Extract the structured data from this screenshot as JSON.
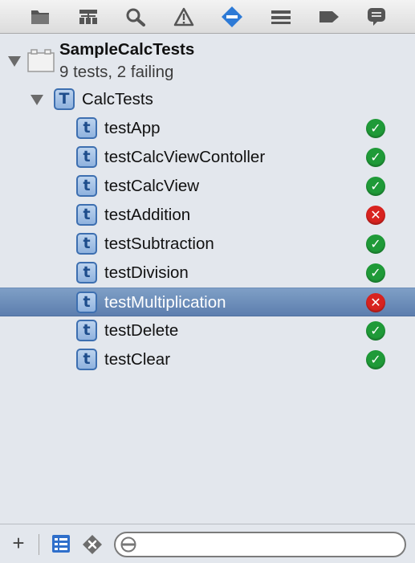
{
  "toolbar": {
    "icons": [
      "folder-icon",
      "hierarchy-icon",
      "search-icon",
      "warning-icon",
      "test-navigator-icon",
      "breakpoint-list-icon",
      "tag-icon",
      "speech-bubble-icon"
    ],
    "active": "test-navigator-icon",
    "accent": "#2d7ad6"
  },
  "tree": {
    "project": {
      "name": "SampleCalcTests",
      "summary": "9 tests, 2 failing"
    },
    "target": {
      "icon_letter": "T",
      "name": "CalcTests"
    },
    "tests": [
      {
        "icon_letter": "t",
        "name": "testApp",
        "status": "pass",
        "status_glyph": "✓"
      },
      {
        "icon_letter": "t",
        "name": "testCalcViewContoller",
        "status": "pass",
        "status_glyph": "✓"
      },
      {
        "icon_letter": "t",
        "name": "testCalcView",
        "status": "pass",
        "status_glyph": "✓"
      },
      {
        "icon_letter": "t",
        "name": "testAddition",
        "status": "fail",
        "status_glyph": "✕"
      },
      {
        "icon_letter": "t",
        "name": "testSubtraction",
        "status": "pass",
        "status_glyph": "✓"
      },
      {
        "icon_letter": "t",
        "name": "testDivision",
        "status": "pass",
        "status_glyph": "✓"
      },
      {
        "icon_letter": "t",
        "name": "testMultiplication",
        "status": "fail",
        "status_glyph": "✕",
        "selected": true
      },
      {
        "icon_letter": "t",
        "name": "testDelete",
        "status": "pass",
        "status_glyph": "✓"
      },
      {
        "icon_letter": "t",
        "name": "testClear",
        "status": "pass",
        "status_glyph": "✓"
      }
    ],
    "colors": {
      "pass": "#1f9a38",
      "fail": "#d8231f",
      "selection": "#6a8bb8"
    }
  },
  "bottom": {
    "add_label": "+",
    "filter": {
      "value": "",
      "placeholder": ""
    }
  }
}
